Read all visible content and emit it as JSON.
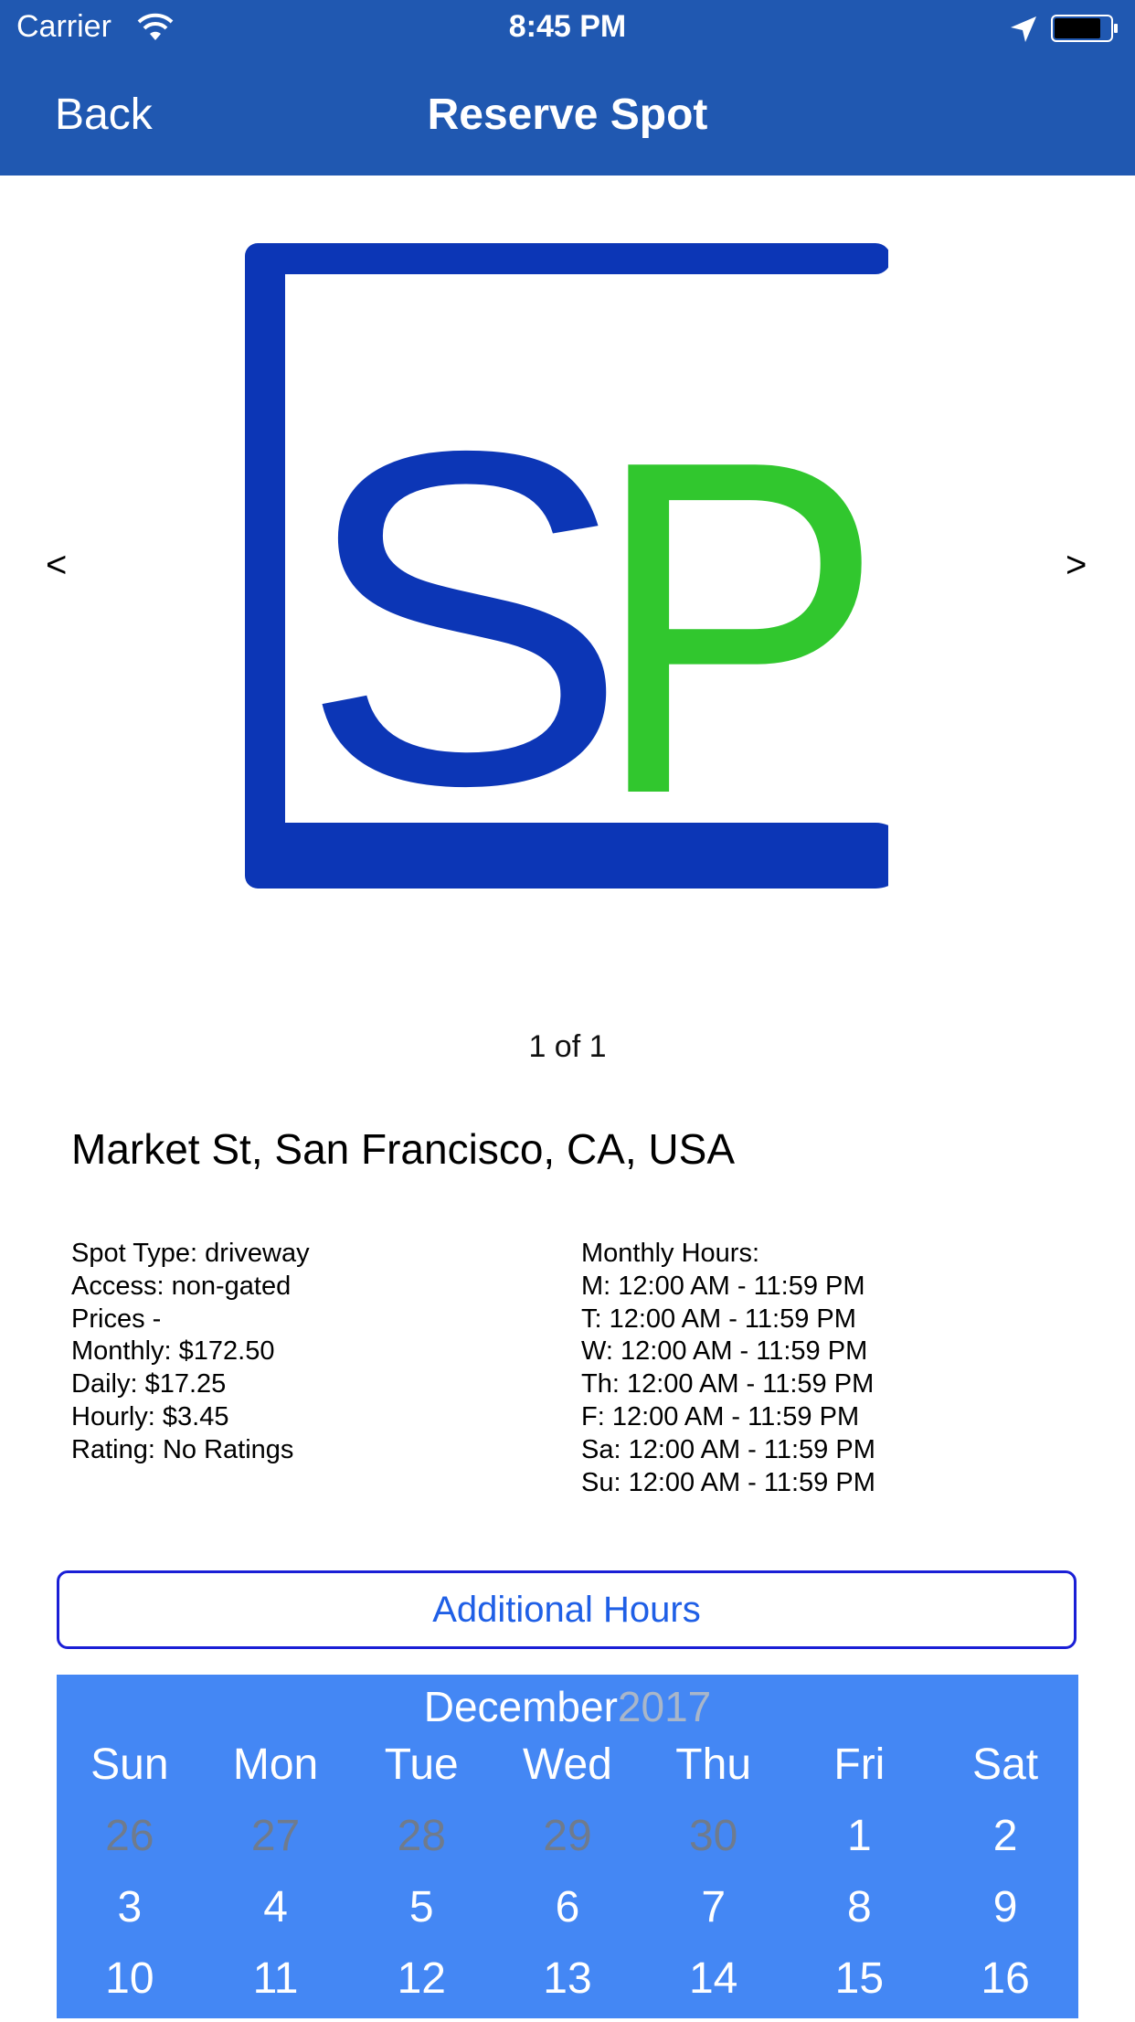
{
  "status_bar": {
    "carrier": "Carrier",
    "time": "8:45 PM",
    "icons": [
      "wifi-icon",
      "location-arrow-icon",
      "battery-icon"
    ]
  },
  "nav": {
    "back_label": "Back",
    "title": "Reserve Spot"
  },
  "carousel": {
    "prev_label": "<",
    "next_label": ">",
    "pager": "1 of 1",
    "logo_text": "SP",
    "logo_colors": {
      "frame_and_s": "#0c36b6",
      "p": "#31c72e"
    }
  },
  "spot": {
    "address": "Market St, San Francisco, CA, USA",
    "details": [
      "Spot Type: driveway",
      "Access: non-gated",
      "Prices -",
      "Monthly: $172.50",
      "Daily: $17.25",
      "Hourly: $3.45",
      "Rating: No Ratings"
    ],
    "hours": [
      "Monthly Hours:",
      "M: 12:00 AM - 11:59 PM",
      "T: 12:00 AM - 11:59 PM",
      "W: 12:00 AM - 11:59 PM",
      "Th: 12:00 AM - 11:59 PM",
      "F: 12:00 AM - 11:59 PM",
      "Sa: 12:00 AM - 11:59 PM",
      "Su: 12:00 AM - 11:59 PM"
    ]
  },
  "additional_hours_label": "Additional Hours",
  "calendar": {
    "month": "December",
    "year": "2017",
    "weekdays": [
      "Sun",
      "Mon",
      "Tue",
      "Wed",
      "Thu",
      "Fri",
      "Sat"
    ],
    "weeks": [
      [
        "26",
        "27",
        "28",
        "29",
        "30",
        "1",
        "2"
      ],
      [
        "3",
        "4",
        "5",
        "6",
        "7",
        "8",
        "9"
      ],
      [
        "10",
        "11",
        "12",
        "13",
        "14",
        "15",
        "16"
      ]
    ],
    "other_month_days_in_first_week": 5
  },
  "colors": {
    "nav_bar": "#2058b1",
    "calendar_bg": "#4487f4",
    "button_border": "#1a1fd6",
    "button_text": "#1f5fe6"
  }
}
